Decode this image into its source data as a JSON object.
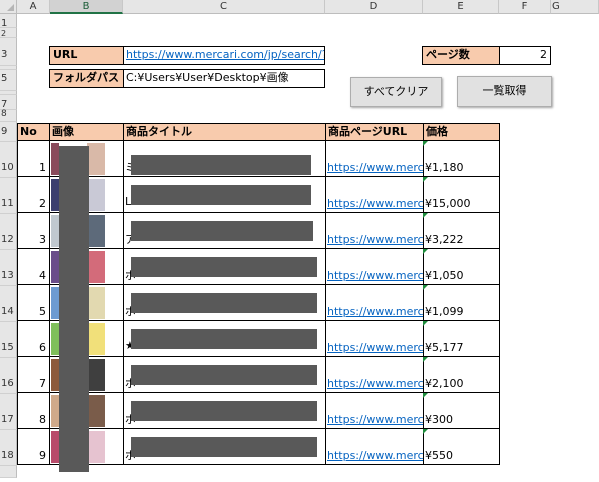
{
  "columns": [
    "A",
    "B",
    "C",
    "D",
    "E",
    "F",
    "G"
  ],
  "rows": [
    "1",
    "2",
    "3",
    "",
    "5",
    "",
    "7",
    "8",
    "9",
    "10",
    "11",
    "12",
    "13",
    "14",
    "15",
    "16",
    "17",
    "18"
  ],
  "form": {
    "url_label": "URL",
    "url_value": "https://www.mercari.com/jp/search/?k",
    "folder_label": "フォルダパス",
    "folder_value": "C:¥Users¥User¥Desktop¥画像",
    "pages_label": "ページ数",
    "pages_value": "2"
  },
  "buttons": {
    "clear": "すべてクリア",
    "fetch": "一覧取得"
  },
  "table": {
    "headers": [
      "No",
      "画像",
      "商品タイトル",
      "商品ページURL",
      "価格"
    ],
    "rows": [
      {
        "no": "1",
        "title_prefix": "ミ",
        "url": "https://www.merca",
        "price": "¥1,180"
      },
      {
        "no": "2",
        "title_prefix": "L",
        "url": "https://www.merca",
        "price": "¥15,000"
      },
      {
        "no": "3",
        "title_prefix": "ア",
        "url": "https://www.merca",
        "price": "¥3,222"
      },
      {
        "no": "4",
        "title_prefix": "ポ",
        "url": "https://www.merca",
        "price": "¥1,050"
      },
      {
        "no": "5",
        "title_prefix": "ポ",
        "url": "https://www.merca",
        "price": "¥1,099"
      },
      {
        "no": "6",
        "title_prefix": "★",
        "url": "https://www.merca",
        "price": "¥5,177"
      },
      {
        "no": "7",
        "title_prefix": "ポ",
        "url": "https://www.merca",
        "price": "¥2,100"
      },
      {
        "no": "8",
        "title_prefix": "ポ",
        "url": "https://www.merca",
        "price": "¥300"
      },
      {
        "no": "9",
        "title_prefix": "ポ",
        "url": "https://www.merca",
        "price": "¥550"
      }
    ]
  }
}
